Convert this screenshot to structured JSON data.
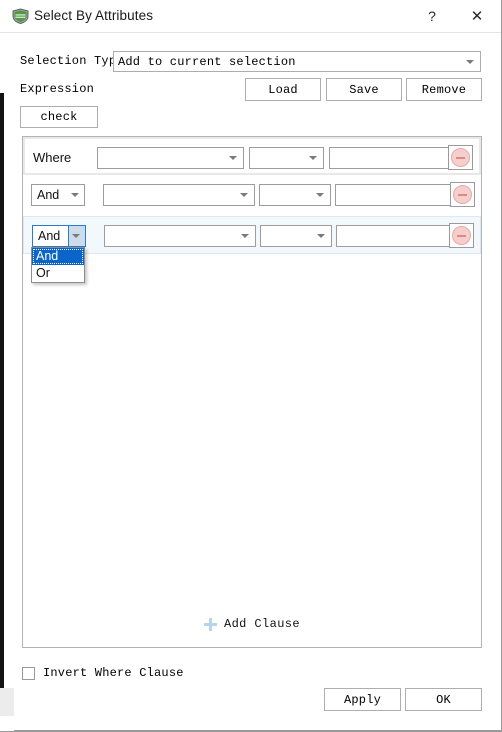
{
  "window": {
    "title": "Select By Attributes",
    "icon": "select-by-attributes-icon",
    "help_label": "?",
    "close_label": "✕"
  },
  "form": {
    "selection_type_label": "Selection Type",
    "selection_type_value": "Add to current selection",
    "selection_type_options": [
      "Add to current selection"
    ],
    "expression_label": "Expression",
    "load_label": "Load",
    "save_label": "Save",
    "remove_label": "Remove",
    "check_label": "check"
  },
  "clauses": [
    {
      "connector_label": "Where",
      "connector_type": "static",
      "field_value": "",
      "operator_value": "",
      "value_value": "",
      "remove_icon": "minus-circle-icon",
      "active": false
    },
    {
      "connector_label": "And",
      "connector_type": "combo",
      "field_value": "",
      "operator_value": "",
      "value_value": "",
      "remove_icon": "minus-circle-icon",
      "active": false
    },
    {
      "connector_label": "And",
      "connector_type": "combo",
      "field_value": "",
      "operator_value": "",
      "value_value": "",
      "remove_icon": "minus-circle-icon",
      "active": true
    }
  ],
  "dropdown": {
    "open": true,
    "owner_row": 2,
    "items": [
      {
        "label": "And",
        "selected": true
      },
      {
        "label": "Or",
        "selected": false
      }
    ],
    "highlight_color": "#0b64c8"
  },
  "add_clause": {
    "label": "Add Clause",
    "icon": "plus-icon",
    "icon_color": "#b7d4ef"
  },
  "invert": {
    "label": "Invert Where Clause",
    "checked": false
  },
  "footer": {
    "apply_label": "Apply",
    "ok_label": "OK"
  },
  "colors": {
    "accent": "#0b64c8",
    "remove_fill": "#f6cfcd",
    "remove_border": "#e8a9a5",
    "active_row_bg": "#f3f8fd",
    "border": "#9a9a9a"
  }
}
